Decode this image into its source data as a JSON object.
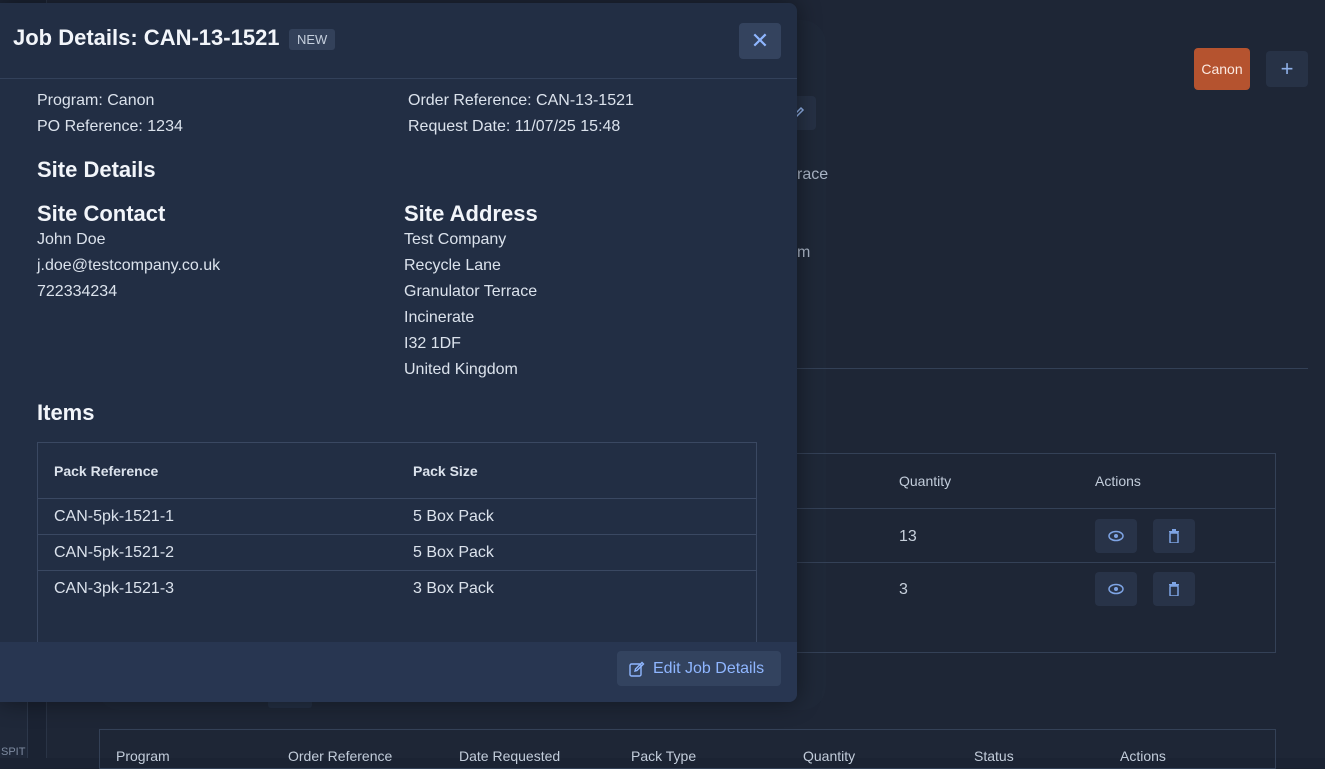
{
  "background": {
    "canon_button": "Canon",
    "plus_button": "+",
    "fragments": [
      "race",
      "m"
    ],
    "table1": {
      "headers": [
        "Quantity",
        "Actions"
      ],
      "rows": [
        {
          "quantity": "13"
        },
        {
          "quantity": "3"
        }
      ]
    },
    "table2": {
      "headers": [
        "Program",
        "Order Reference",
        "Date Requested",
        "Pack Type",
        "Quantity",
        "Status",
        "Actions"
      ]
    },
    "sidebar_text": "SPIT"
  },
  "modal": {
    "title": "Job Details: CAN-13-1521",
    "badge": "NEW",
    "close_label": "✕",
    "program": "Program: Canon",
    "po_reference": "PO Reference: 1234",
    "order_reference": "Order Reference: CAN-13-1521",
    "request_date": "Request Date: 11/07/25 15:48",
    "site_details_heading": "Site Details",
    "site_contact": {
      "heading": "Site Contact",
      "name": "John Doe",
      "email": "j.doe@testcompany.co.uk",
      "phone": "722334234"
    },
    "site_address": {
      "heading": "Site Address",
      "lines": [
        "Test Company",
        "Recycle Lane",
        "Granulator Terrace",
        "Incinerate",
        "I32 1DF",
        "United Kingdom"
      ]
    },
    "items_heading": "Items",
    "items_table": {
      "headers": [
        "Pack Reference",
        "Pack Size"
      ],
      "rows": [
        {
          "ref": "CAN-5pk-1521-1",
          "size": "5 Box Pack"
        },
        {
          "ref": "CAN-5pk-1521-2",
          "size": "5 Box Pack"
        },
        {
          "ref": "CAN-3pk-1521-3",
          "size": "3 Box Pack"
        }
      ]
    },
    "edit_button": "Edit Job Details"
  },
  "colors": {
    "accent": "#8fb6ff",
    "canon_brand": "#b5532f",
    "modal_bg": "#222e44"
  }
}
